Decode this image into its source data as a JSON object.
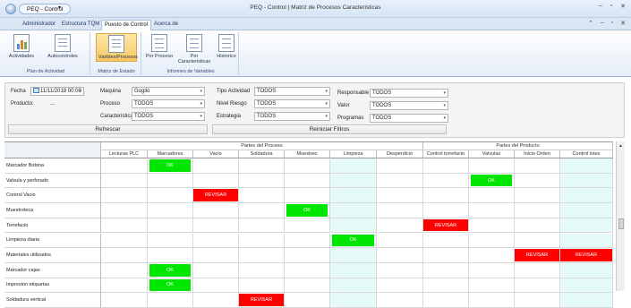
{
  "app": {
    "name": "PEQ - Control",
    "title": "PEQ - Control | Matriz de Procesos Caracteristicas"
  },
  "menu": {
    "tabs": [
      "Administrador",
      "Estructura TQM",
      "Puesto de Control",
      "Acerca de"
    ],
    "active": 2
  },
  "ribbon": {
    "group1": {
      "label": "Plan de Actividad",
      "buttons": [
        "Actividades",
        "Autocontroles"
      ]
    },
    "group2": {
      "label": "Matriz de Estado",
      "buttons": [
        "Varibles/Procesos"
      ]
    },
    "group3": {
      "label": "Informes de Variables",
      "buttons": [
        "Por Proceso",
        "Por Caracteristicas",
        "Historico"
      ]
    }
  },
  "filters": {
    "fecha_label": "Fecha",
    "fecha_value": "11/11/2018 00:00",
    "producto_label": "Producto:",
    "producto_value": "...",
    "maquina_label": "Maquina",
    "maquina_value": "Goglio",
    "proceso_label": "Proceso",
    "proceso_value": "TODOS",
    "caracteristica_label": "Caracteristica",
    "caracteristica_value": "TODOS",
    "tipo_label": "Tipo Actividad",
    "tipo_value": "TODOS",
    "nivel_label": "Nivel Riesgo",
    "nivel_value": "TODOS",
    "estrategia_label": "Estrategia",
    "estrategia_value": "TODOS",
    "responsable_label": "Responsable",
    "responsable_value": "TODOS",
    "valor_label": "Valor",
    "valor_value": "TODOS",
    "programas_label": "Programas",
    "programas_value": "TODOS",
    "refrescar": "Refrescar",
    "reiniciar": "Reiniciar Filtros"
  },
  "grid": {
    "group_proceso": "Partes del Proceso",
    "group_producto": "Partes del Producto",
    "columns": [
      "Lecturas PLC",
      "Marcadores",
      "Vacio",
      "Soldadura",
      "Muestreo",
      "Limpieza",
      "Desperdicio",
      "Control torrefacto",
      "Valvulas",
      "Inicio Orden",
      "Control lotes"
    ],
    "rows": [
      {
        "label": "Marcador Bobina",
        "status": [
          "",
          "OK",
          "",
          "",
          "",
          "",
          "",
          "",
          "",
          "",
          ""
        ]
      },
      {
        "label": "Valvula y perforado",
        "status": [
          "",
          "",
          "",
          "",
          "",
          "",
          "",
          "",
          "OK",
          "",
          ""
        ]
      },
      {
        "label": "Control Vacio",
        "status": [
          "",
          "",
          "REVISAR",
          "",
          "",
          "",
          "",
          "",
          "",
          "",
          ""
        ]
      },
      {
        "label": "Muestroteca",
        "status": [
          "",
          "",
          "",
          "",
          "OK",
          "",
          "",
          "",
          "",
          "",
          ""
        ]
      },
      {
        "label": "Torrefacto",
        "status": [
          "",
          "",
          "",
          "",
          "",
          "",
          "",
          "REVISAR",
          "",
          "",
          ""
        ]
      },
      {
        "label": "Limpieza diaria",
        "status": [
          "",
          "",
          "",
          "",
          "",
          "OK",
          "",
          "",
          "",
          "",
          ""
        ]
      },
      {
        "label": "Materiales utilizados",
        "status": [
          "",
          "",
          "",
          "",
          "",
          "",
          "",
          "",
          "",
          "REVISAR",
          "REVISAR"
        ]
      },
      {
        "label": "Marcador cajas",
        "status": [
          "",
          "OK",
          "",
          "",
          "",
          "",
          "",
          "",
          "",
          "",
          ""
        ]
      },
      {
        "label": "Impresion etiquetas",
        "status": [
          "",
          "OK",
          "",
          "",
          "",
          "",
          "",
          "",
          "",
          "",
          ""
        ]
      },
      {
        "label": "Soldadura vertical",
        "status": [
          "",
          "",
          "",
          "REVISAR",
          "",
          "",
          "",
          "",
          "",
          "",
          ""
        ]
      }
    ]
  },
  "colors": {
    "ok": "#00e600",
    "revisar": "#ff0000",
    "col_tint": "#e6fafa"
  }
}
